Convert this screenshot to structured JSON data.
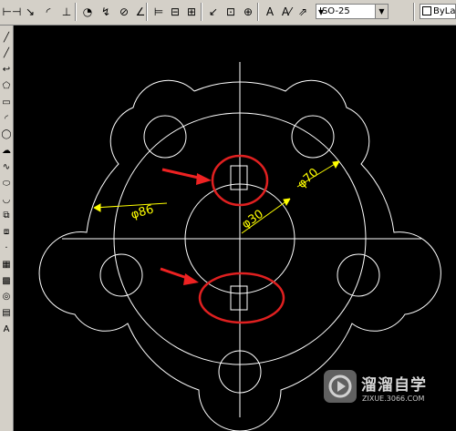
{
  "toolbar": {
    "dim_style_value": "ISO-25",
    "layer_value": "ByLay",
    "icons": [
      "dim-linear-icon",
      "dim-aligned-icon",
      "dim-arc-length-icon",
      "dim-ordinate-icon",
      "dim-radius-icon",
      "dim-jogged-icon",
      "dim-diameter-icon",
      "dim-angular-icon",
      "quick-dim-icon",
      "dim-baseline-icon",
      "dim-continue-icon",
      "quick-leader-icon",
      "tolerance-icon",
      "center-mark-icon",
      "dim-edit-icon",
      "dim-text-edit-icon",
      "dim-update-icon",
      "dim-style-icon"
    ],
    "icon_glyphs": [
      "⊢⊣",
      "↘",
      "◜",
      "⊥",
      "◔",
      "↯",
      "⊘",
      "∠",
      "⊨",
      "⊟",
      "⊞",
      "↙",
      "⊡",
      "⊕",
      "A",
      "A⁄",
      "⇗",
      "▾"
    ]
  },
  "sidebar": {
    "icons": [
      "line-icon",
      "construction-line-icon",
      "polyline-icon",
      "polygon-icon",
      "rectangle-icon",
      "arc-icon",
      "circle-icon",
      "revision-cloud-icon",
      "spline-icon",
      "ellipse-icon",
      "ellipse-arc-icon",
      "insert-block-icon",
      "make-block-icon",
      "point-icon",
      "hatch-icon",
      "gradient-icon",
      "region-icon",
      "table-icon",
      "multiline-text-icon"
    ],
    "glyphs": [
      "╱",
      "╱",
      "↩",
      "⬠",
      "▭",
      "◜",
      "◯",
      "☁",
      "∿",
      "⬭",
      "◡",
      "⧉",
      "⧈",
      "·",
      "▦",
      "▩",
      "◎",
      "▤",
      "A"
    ]
  },
  "drawing": {
    "dimensions": [
      "φ86",
      "φ30",
      "φ70"
    ],
    "colors": {
      "background": "#000000",
      "geometry": "#ffffff",
      "dimension": "#ffff00",
      "callout_circle": "#e02020",
      "arrow": "#ee2222"
    }
  },
  "watermark": {
    "brand": "溜溜自学",
    "url": "ZIXUE.3066.COM"
  }
}
